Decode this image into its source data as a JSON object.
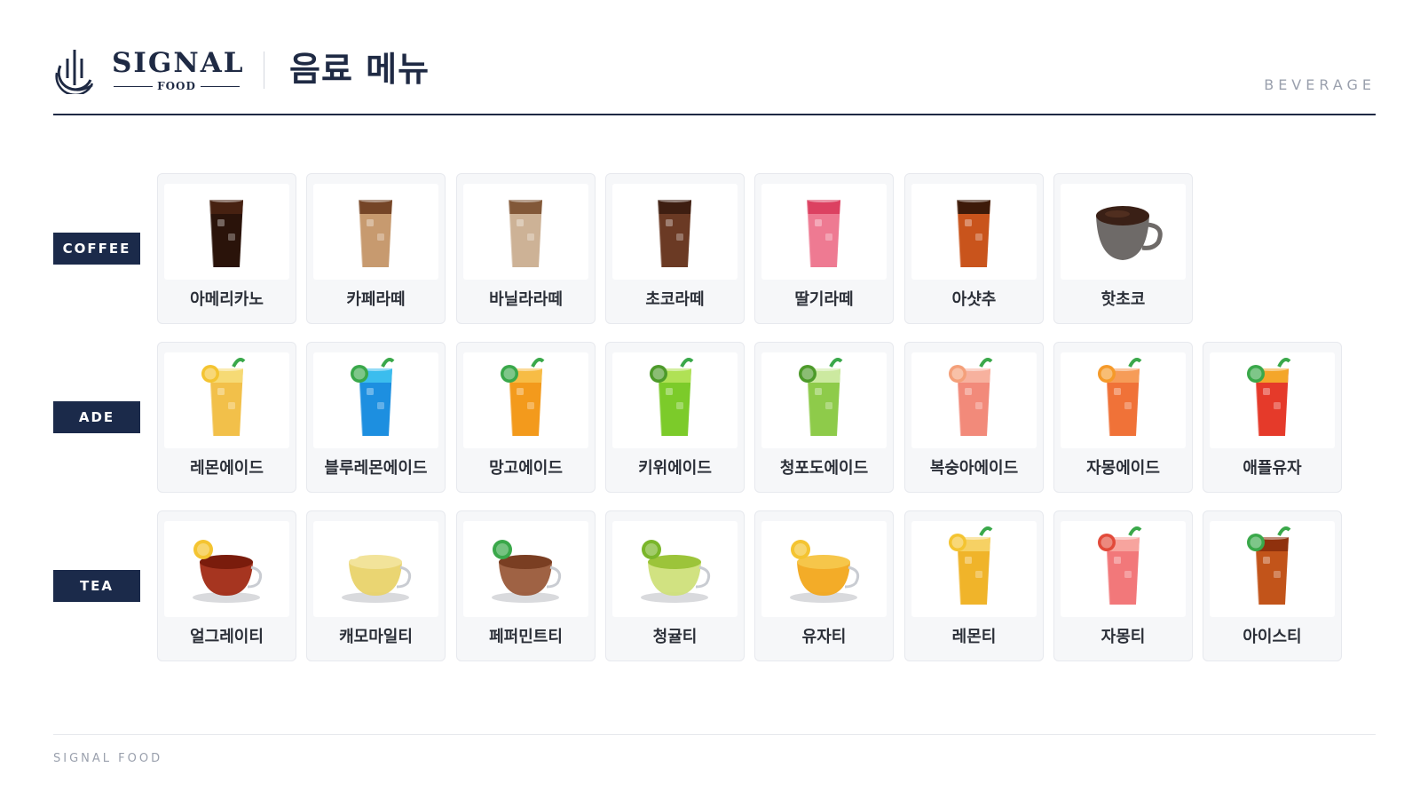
{
  "brand": {
    "name": "SIGNAL",
    "sub": "FOOD"
  },
  "header": {
    "title": "음료 메뉴",
    "tag": "BEVERAGE"
  },
  "colors": {
    "navy": "#1b2a4a",
    "card_bg": "#f6f7f9"
  },
  "sections": [
    {
      "label": "COFFEE",
      "items": [
        {
          "name": "아메리카노",
          "icon": "iced-americano-icon",
          "liquid": "#2a130a",
          "top": "#4a2412",
          "kind": "glass"
        },
        {
          "name": "카페라떼",
          "icon": "iced-latte-icon",
          "liquid": "#c79a6f",
          "top": "#6b3c1f",
          "kind": "glass"
        },
        {
          "name": "바닐라라떼",
          "icon": "vanilla-latte-icon",
          "liquid": "#cdb296",
          "top": "#7a4e2d",
          "kind": "glass"
        },
        {
          "name": "초코라떼",
          "icon": "choco-latte-icon",
          "liquid": "#6b3a24",
          "top": "#3a1c10",
          "kind": "glass"
        },
        {
          "name": "딸기라떼",
          "icon": "strawberry-latte-icon",
          "liquid": "#ee7a92",
          "top": "#d93b5c",
          "kind": "glass"
        },
        {
          "name": "아샷추",
          "icon": "peach-iced-tea-shot-icon",
          "liquid": "#c9541c",
          "top": "#2e1408",
          "kind": "glass"
        },
        {
          "name": "핫초코",
          "icon": "hot-chocolate-icon",
          "liquid": "#3a2016",
          "top": "#6e6a68",
          "kind": "mug"
        }
      ]
    },
    {
      "label": "ADE",
      "items": [
        {
          "name": "레몬에이드",
          "icon": "lemonade-icon",
          "liquid": "#f2c04a",
          "top": "#f6dd7a",
          "kind": "glass",
          "garnish": "#f4c431"
        },
        {
          "name": "블루레몬에이드",
          "icon": "blue-lemonade-icon",
          "liquid": "#1d8fe0",
          "top": "#3fc2ef",
          "kind": "glass",
          "garnish": "#3aa84a"
        },
        {
          "name": "망고에이드",
          "icon": "mango-ade-icon",
          "liquid": "#f39a1c",
          "top": "#f7c04a",
          "kind": "glass",
          "garnish": "#3aa84a"
        },
        {
          "name": "키위에이드",
          "icon": "kiwi-ade-icon",
          "liquid": "#7ccb2a",
          "top": "#b6e35a",
          "kind": "glass",
          "garnish": "#4d9a2a"
        },
        {
          "name": "청포도에이드",
          "icon": "green-grape-ade-icon",
          "liquid": "#8ecb4a",
          "top": "#d3ecaa",
          "kind": "glass",
          "garnish": "#4d9a2a"
        },
        {
          "name": "복숭아에이드",
          "icon": "peach-ade-icon",
          "liquid": "#f28a7a",
          "top": "#f7b5a2",
          "kind": "glass",
          "garnish": "#f4a07a"
        },
        {
          "name": "자몽에이드",
          "icon": "grapefruit-ade-icon",
          "liquid": "#f07238",
          "top": "#f6a15c",
          "kind": "glass",
          "garnish": "#f59a2a"
        },
        {
          "name": "애플유자",
          "icon": "apple-yuja-icon",
          "liquid": "#e53a2a",
          "top": "#f5b22a",
          "kind": "glass",
          "garnish": "#3aa84a"
        }
      ]
    },
    {
      "label": "TEA",
      "items": [
        {
          "name": "얼그레이티",
          "icon": "earl-grey-tea-icon",
          "liquid": "#a12a14",
          "top": "#7a1c0c",
          "kind": "cup",
          "garnish": "#f4c431"
        },
        {
          "name": "캐모마일티",
          "icon": "chamomile-tea-icon",
          "liquid": "#e9d36a",
          "top": "#f2e39a",
          "kind": "cup",
          "garnish": "#ffffff"
        },
        {
          "name": "페퍼민트티",
          "icon": "peppermint-tea-icon",
          "liquid": "#9a5a3a",
          "top": "#7a3e22",
          "kind": "cup",
          "garnish": "#3aa84a"
        },
        {
          "name": "청귤티",
          "icon": "green-tangerine-tea-icon",
          "liquid": "#cfe07a",
          "top": "#9cc43a",
          "kind": "cup",
          "garnish": "#7ab62a"
        },
        {
          "name": "유자티",
          "icon": "yuja-tea-icon",
          "liquid": "#f2a81c",
          "top": "#f6c64a",
          "kind": "cup",
          "garnish": "#f4c431"
        },
        {
          "name": "레몬티",
          "icon": "iced-lemon-tea-icon",
          "liquid": "#f0b42a",
          "top": "#f6d46a",
          "kind": "glass",
          "garnish": "#f4c431"
        },
        {
          "name": "자몽티",
          "icon": "grapefruit-tea-icon",
          "liquid": "#f2787a",
          "top": "#f7a8a2",
          "kind": "glass",
          "garnish": "#e24a3a"
        },
        {
          "name": "아이스티",
          "icon": "iced-tea-icon",
          "liquid": "#c2541a",
          "top": "#8a2e0c",
          "kind": "glass",
          "garnish": "#3aa84a"
        }
      ]
    }
  ],
  "footer": "SIGNAL FOOD"
}
